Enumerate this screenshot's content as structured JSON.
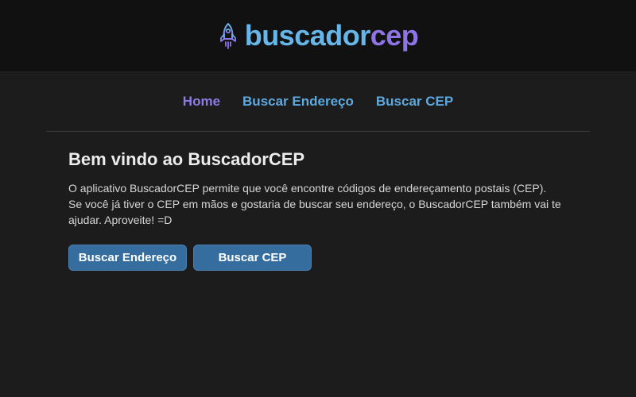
{
  "header": {
    "logo_icon": "rocket-icon",
    "logo_part1": "buscador",
    "logo_part2": "cep"
  },
  "nav": {
    "home": "Home",
    "buscar_endereco": "Buscar Endereço",
    "buscar_cep": "Buscar CEP"
  },
  "main": {
    "title": "Bem vindo ao BuscadorCEP",
    "paragraph_line1": "O aplicativo BuscadorCEP permite que você encontre códigos de endereçamento postais (CEP).",
    "paragraph_line2": "Se você já tiver o CEP em mãos e gostaria de buscar seu endereço, o BuscadorCEP também vai te ajudar. Aproveite! =D",
    "button_endereco": "Buscar Endereço",
    "button_cep": "Buscar CEP"
  },
  "colors": {
    "background": "#1c1c1d",
    "header_background": "#111112",
    "logo_blue": "#67b6e9",
    "logo_purple": "#8e74e4",
    "nav_active": "#8e7ce6",
    "nav_link": "#5ea9de",
    "button": "#356e9e"
  }
}
